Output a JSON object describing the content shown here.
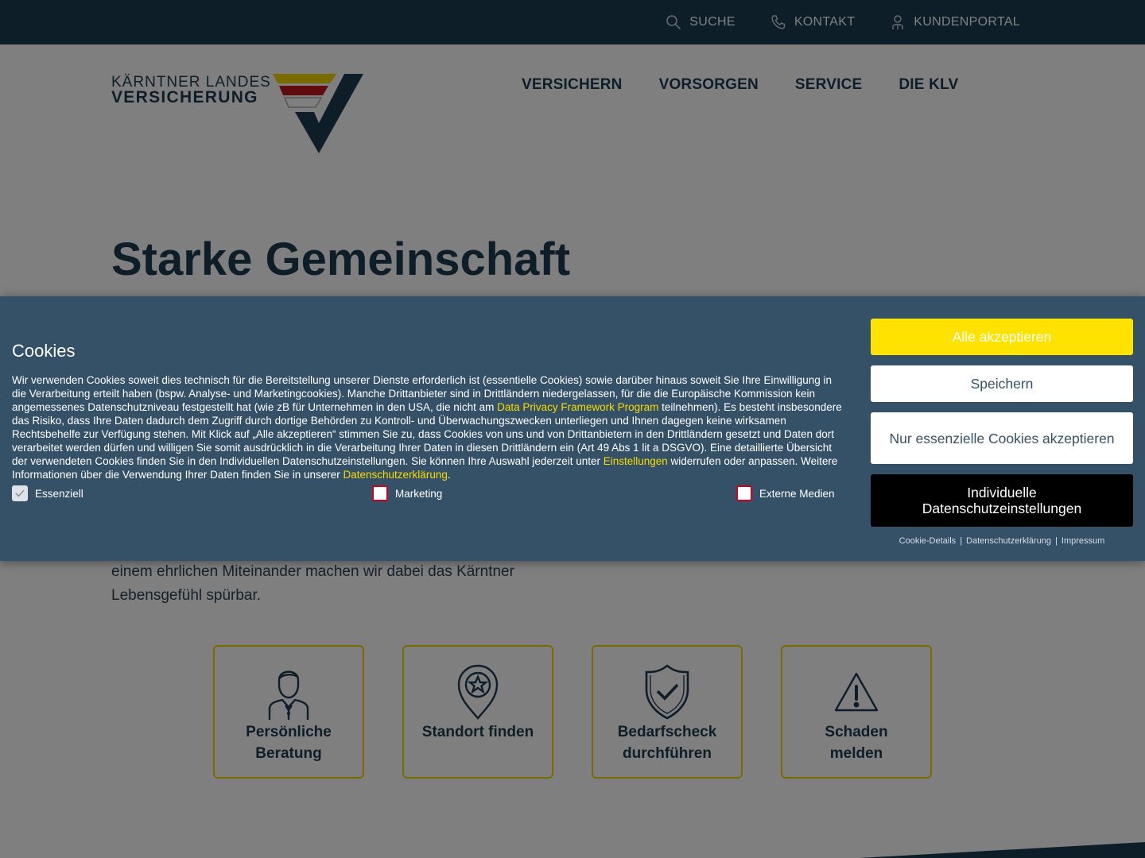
{
  "topbar": {
    "search": "SUCHE",
    "contact": "KONTAKT",
    "portal": "KUNDENPORTAL"
  },
  "logo": {
    "line1": "KÄRNTNER LANDES",
    "line2": "VERSICHERUNG"
  },
  "nav": [
    "VERSICHERN",
    "VORSORGEN",
    "SERVICE",
    "DIE KLV"
  ],
  "hero": {
    "title": "Starke Gemeinschaft",
    "text": "einem ehrlichen Miteinander machen wir dabei das Kärntner Lebensgefühl spürbar."
  },
  "cards": [
    {
      "label": "Persönliche Beratung",
      "icon": "advisor-icon"
    },
    {
      "label": "Standort finden",
      "icon": "location-pin-icon"
    },
    {
      "label": "Bedarfscheck durchführen",
      "icon": "shield-check-icon"
    },
    {
      "label": "Schaden melden",
      "icon": "warning-icon"
    }
  ],
  "cookie": {
    "title": "Cookies",
    "text_1": "Wir verwenden Cookies soweit dies technisch für die Bereitstellung unserer Dienste erforderlich ist (essentielle Cookies) sowie darüber hinaus soweit Sie Ihre Einwilligung in die Verarbeitung erteilt haben (bspw. Analyse- und Marketingcookies). Manche Drittanbieter sind in Drittländern niedergelassen, für die die Europäische Kommission kein angemessenes Datenschutzniveau festgestellt hat (wie zB für Unternehmen in den USA, die nicht am ",
    "link_dpf": "Data Privacy Framework Program",
    "text_2": " teilnehmen). Es besteht insbesondere das Risiko, dass Ihre Daten dadurch dem Zugriff durch dortige Behörden zu Kontroll- und Überwachungszwecken unterliegen und Ihnen dagegen keine wirksamen Rechtsbehelfe zur Verfügung stehen. Mit Klick auf „Alle akzeptieren“ stimmen Sie zu, dass Cookies von uns und von Drittanbietern in den Drittländern gesetzt und Daten dort verarbeitet werden dürfen und willigen Sie somit ausdrücklich in die Verarbeitung Ihrer Daten in diesen Drittländern ein (Art 49 Abs 1 lit a DSGVO). Eine detaillierte Übersicht der verwendeten Cookies finden Sie in den Individuellen Datenschutzeinstellungen. Sie können Ihre Auswahl jederzeit unter ",
    "link_settings": "Einstellungen",
    "text_3": " widerrufen oder anpassen. Weitere Informationen über die Verwendung Ihrer Daten finden Sie in unserer ",
    "link_privacy": "Datenschutzerklärung",
    "text_4": ".",
    "checks": {
      "essential": "Essenziell",
      "marketing": "Marketing",
      "external": "Externe Medien"
    },
    "buttons": {
      "accept_all": "Alle akzeptieren",
      "save": "Speichern",
      "essential_only": "Nur essenzielle Cookies akzeptieren",
      "individual": "Individuelle Datenschutzeinstellungen"
    },
    "footer": {
      "details": "Cookie-Details",
      "privacy": "Datenschutzerklärung",
      "imprint": "Impressum",
      "sep": "|"
    }
  },
  "colors": {
    "navy": "#1d3c52",
    "banner": "#355168",
    "yellow": "#ffe300",
    "logo_yellow": "#f2d600",
    "logo_red": "#c0161b"
  }
}
